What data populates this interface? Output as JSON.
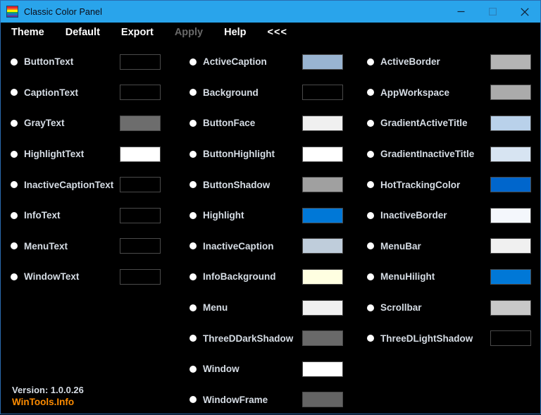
{
  "window": {
    "title": "Classic Color Panel",
    "icon_name": "rainbow-palette-icon",
    "icon_stripes": [
      "#e8272c",
      "#f4821f",
      "#fff200",
      "#16a75c",
      "#1c6fc4",
      "#6b2d8f"
    ],
    "titlebar_color": "#29A4EB",
    "border_color": "#2b6cb0",
    "background_color": "#000000",
    "controls": {
      "minimize": "–",
      "maximize": "□",
      "close": "✕"
    }
  },
  "menu": {
    "items": [
      {
        "label": "Theme",
        "disabled": false
      },
      {
        "label": "Default",
        "disabled": false
      },
      {
        "label": "Export",
        "disabled": false
      },
      {
        "label": "Apply",
        "disabled": true
      },
      {
        "label": "Help",
        "disabled": false
      },
      {
        "label": "<<<",
        "disabled": false
      }
    ]
  },
  "columns": [
    {
      "id": "col-1",
      "rows": [
        {
          "label": "ButtonText",
          "color": "#000000"
        },
        {
          "label": "CaptionText",
          "color": "#000000"
        },
        {
          "label": "GrayText",
          "color": "#6D6D6D"
        },
        {
          "label": "HighlightText",
          "color": "#FFFFFF"
        },
        {
          "label": "InactiveCaptionText",
          "color": "#000000"
        },
        {
          "label": "InfoText",
          "color": "#000000"
        },
        {
          "label": "MenuText",
          "color": "#000000"
        },
        {
          "label": "WindowText",
          "color": "#000000"
        }
      ]
    },
    {
      "id": "col-2",
      "rows": [
        {
          "label": "ActiveCaption",
          "color": "#99B4D1"
        },
        {
          "label": "Background",
          "color": "#000000"
        },
        {
          "label": "ButtonFace",
          "color": "#F0F0F0"
        },
        {
          "label": "ButtonHighlight",
          "color": "#FFFFFF"
        },
        {
          "label": "ButtonShadow",
          "color": "#A0A0A0"
        },
        {
          "label": "Highlight",
          "color": "#0078D7"
        },
        {
          "label": "InactiveCaption",
          "color": "#BFCDDB"
        },
        {
          "label": "InfoBackground",
          "color": "#FFFFE1"
        },
        {
          "label": "Menu",
          "color": "#F0F0F0"
        },
        {
          "label": "ThreeDDarkShadow",
          "color": "#696969"
        },
        {
          "label": "Window",
          "color": "#FFFFFF"
        },
        {
          "label": "WindowFrame",
          "color": "#646464"
        }
      ]
    },
    {
      "id": "col-3",
      "rows": [
        {
          "label": "ActiveBorder",
          "color": "#B4B4B4"
        },
        {
          "label": "AppWorkspace",
          "color": "#ABABAB"
        },
        {
          "label": "GradientActiveTitle",
          "color": "#B9D1EA"
        },
        {
          "label": "GradientInactiveTitle",
          "color": "#D7E4F2"
        },
        {
          "label": "HotTrackingColor",
          "color": "#0066CC"
        },
        {
          "label": "InactiveBorder",
          "color": "#F4F7FC"
        },
        {
          "label": "MenuBar",
          "color": "#F0F0F0"
        },
        {
          "label": "MenuHilight",
          "color": "#0078D7"
        },
        {
          "label": "Scrollbar",
          "color": "#C8C8C8"
        },
        {
          "label": "ThreeDLightShadow",
          "color": "#000000"
        }
      ]
    }
  ],
  "footer": {
    "version": "Version: 1.0.0.26",
    "brand": "WinTools.Info",
    "brand_color": "#FF8C00"
  }
}
